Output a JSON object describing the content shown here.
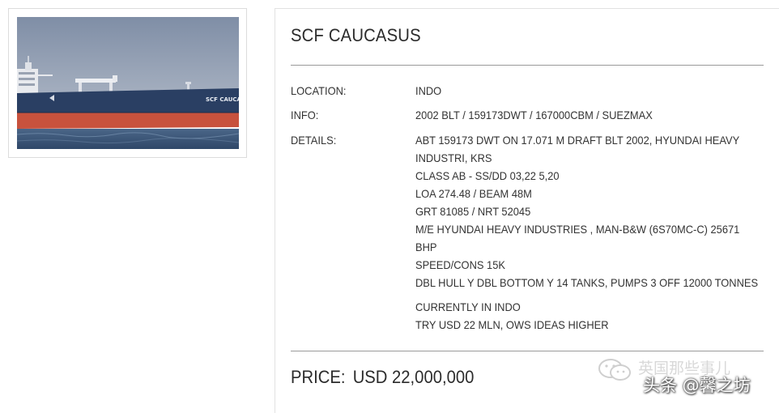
{
  "vessel": {
    "name": "SCF CAUCASUS",
    "hull_marking": "SCF CAUCASUS"
  },
  "fields": {
    "location_label": "LOCATION:",
    "location_value": "INDO",
    "info_label": "INFO:",
    "info_value": "2002 BLT / 159173DWT / 167000CBM / SUEZMAX",
    "details_label": "DETAILS:",
    "details_lines": [
      "ABT 159173 DWT ON 17.071 M DRAFT BLT 2002, HYUNDAI HEAVY",
      "INDUSTRI, KRS",
      "CLASS AB - SS/DD 03,22 5,20",
      "LOA 274.48 / BEAM 48M",
      "GRT 81085 / NRT 52045",
      "M/E HYUNDAI HEAVY INDUSTRIES , MAN-B&W (6S70MC-C) 25671",
      "BHP",
      "SPEED/CONS 15K",
      "DBL HULL Y DBL BOTTOM Y 14 TANKS, PUMPS 3 OFF 12000 TONNES",
      "CURRENTLY IN INDO",
      "TRY USD 22 MLN, OWS IDEAS HIGHER"
    ]
  },
  "price": {
    "label": "PRICE:",
    "value": "USD 22,000,000"
  },
  "watermark": {
    "line1": "英国那些事儿",
    "line2": "头条 @馨之坊",
    "icon": "wechat-icon"
  },
  "colors": {
    "hull_upper": "#2a3f63",
    "hull_lower": "#c8523d",
    "sky": "#8e9bb0",
    "sea": "#3f5a7e",
    "divider": "#9a9a9a"
  }
}
